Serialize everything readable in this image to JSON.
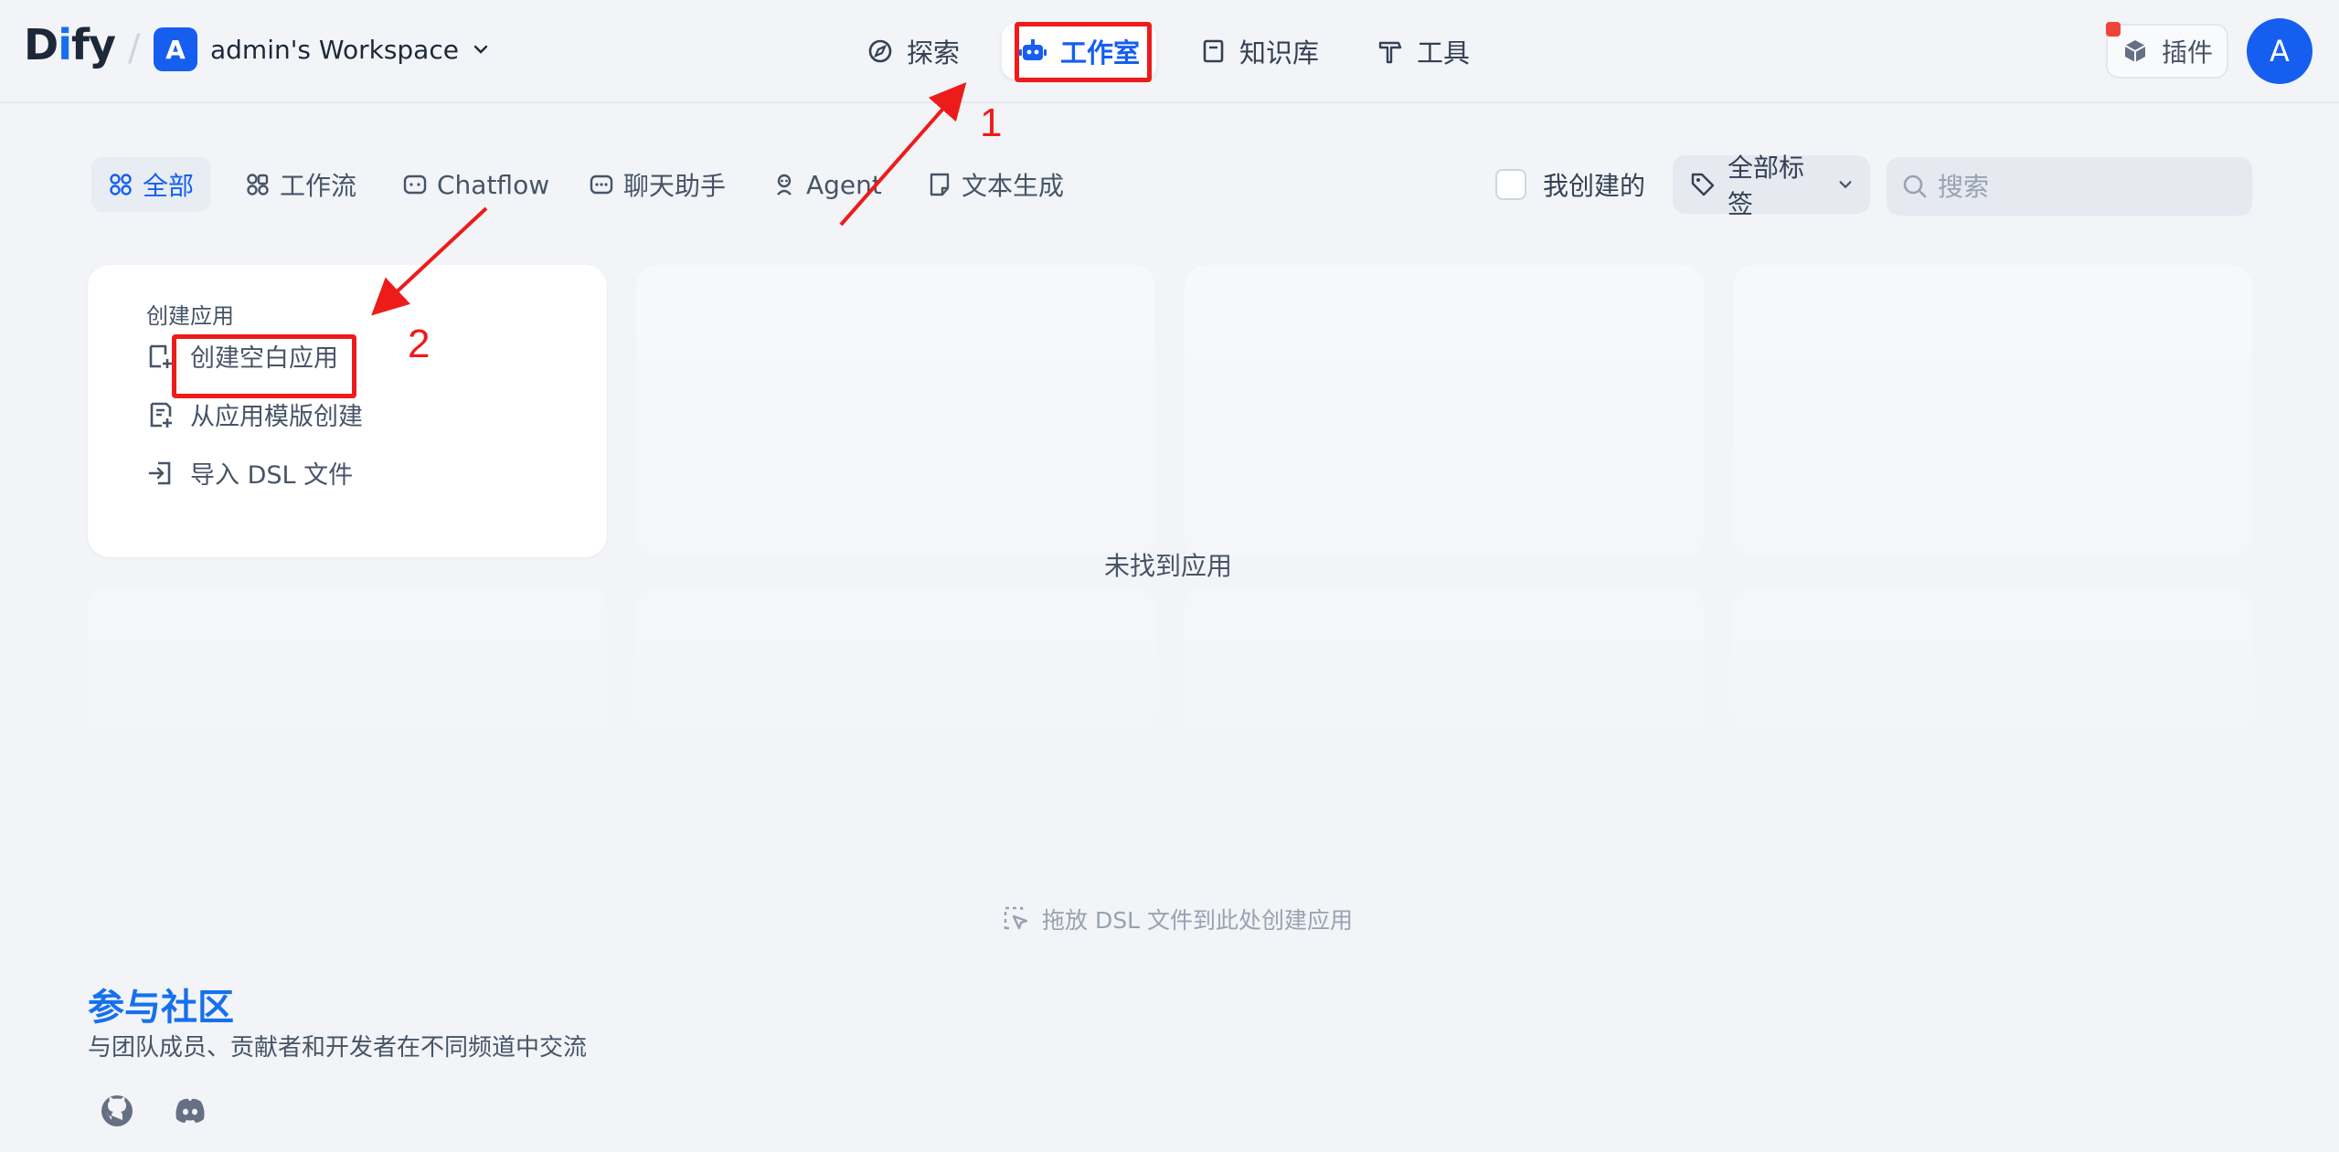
{
  "header": {
    "logo_prefix": "D",
    "logo_i": "i",
    "logo_suffix": "fy",
    "separator": "/",
    "workspace_badge": "A",
    "workspace_name": "admin's Workspace",
    "nav": [
      {
        "label": "探索",
        "icon": "compass-icon"
      },
      {
        "label": "工作室",
        "icon": "robot-icon",
        "active": true
      },
      {
        "label": "知识库",
        "icon": "book-icon"
      },
      {
        "label": "工具",
        "icon": "hammer-icon"
      }
    ],
    "plugins_label": "插件",
    "avatar_letter": "A"
  },
  "filters": {
    "tabs": [
      {
        "label": "全部",
        "icon": "grid-icon",
        "active": true
      },
      {
        "label": "工作流",
        "icon": "workflow-icon"
      },
      {
        "label": "Chatflow",
        "icon": "chatflow-icon"
      },
      {
        "label": "聊天助手",
        "icon": "chat-bubble-icon"
      },
      {
        "label": "Agent",
        "icon": "agent-icon"
      },
      {
        "label": "文本生成",
        "icon": "document-icon"
      }
    ],
    "created_by_me_label": "我创建的",
    "tags_label": "全部标签",
    "search_placeholder": "搜索"
  },
  "create_card": {
    "title": "创建应用",
    "items": [
      {
        "label": "创建空白应用",
        "icon": "blank-app-icon"
      },
      {
        "label": "从应用模版创建",
        "icon": "template-icon"
      },
      {
        "label": "导入 DSL 文件",
        "icon": "import-icon"
      }
    ]
  },
  "empty_text": "未找到应用",
  "drop_hint": "拖放 DSL 文件到此处创建应用",
  "community": {
    "title": "参与社区",
    "subtitle": "与团队成员、贡献者和开发者在不同频道中交流",
    "links": [
      "github-icon",
      "discord-icon"
    ]
  },
  "annotations": {
    "step1": "1",
    "step2": "2",
    "color": "#ee1b1b"
  },
  "colors": {
    "accent": "#155eef",
    "background": "#f2f4f7",
    "annotation": "#ee1b1b"
  }
}
